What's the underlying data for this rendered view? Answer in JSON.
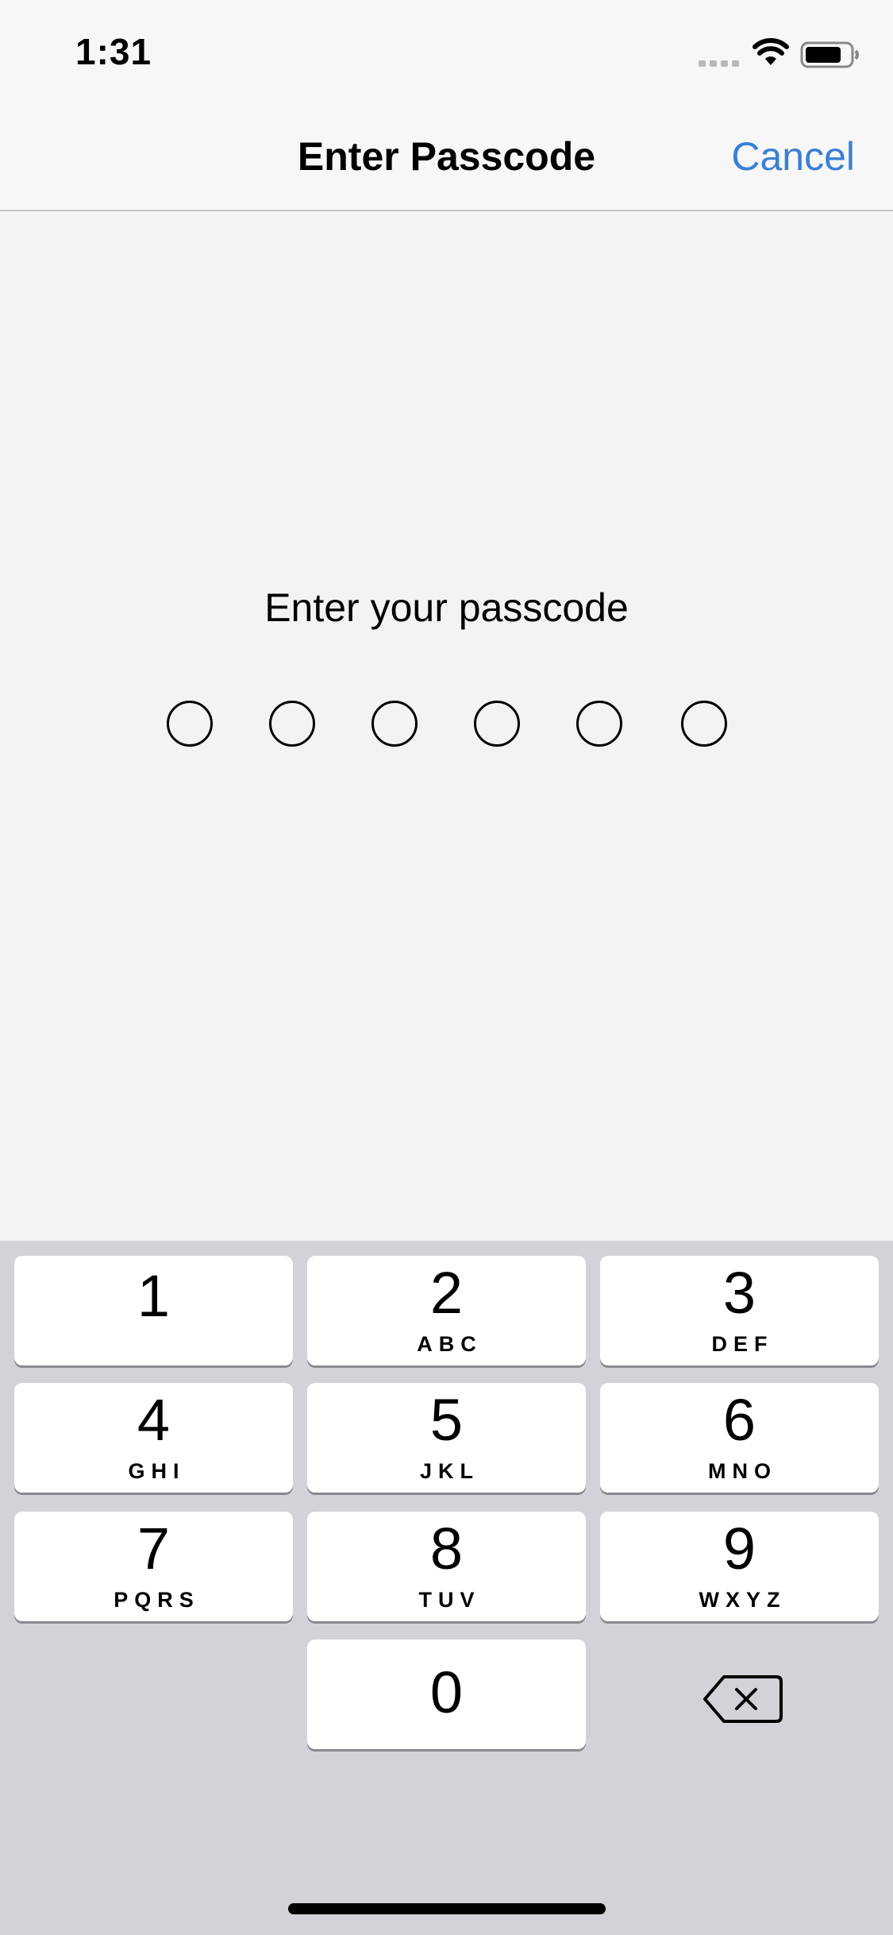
{
  "status_bar": {
    "time": "1:31",
    "icons": [
      "signal-icon",
      "wifi-icon",
      "battery-icon"
    ]
  },
  "nav": {
    "title": "Enter Passcode",
    "cancel_label": "Cancel"
  },
  "prompt": "Enter your passcode",
  "passcode": {
    "length": 6,
    "entered": 0
  },
  "keypad": {
    "keys": [
      {
        "num": "1",
        "letters": ""
      },
      {
        "num": "2",
        "letters": "ABC"
      },
      {
        "num": "3",
        "letters": "DEF"
      },
      {
        "num": "4",
        "letters": "GHI"
      },
      {
        "num": "5",
        "letters": "JKL"
      },
      {
        "num": "6",
        "letters": "MNO"
      },
      {
        "num": "7",
        "letters": "PQRS"
      },
      {
        "num": "8",
        "letters": "TUV"
      },
      {
        "num": "9",
        "letters": "WXYZ"
      },
      {
        "num": "0",
        "letters": ""
      }
    ],
    "delete_icon": "delete-backspace-icon"
  },
  "colors": {
    "accent": "#3a7fd5",
    "background": "#f2f2f7",
    "keypad_background": "#d1d3d9"
  }
}
